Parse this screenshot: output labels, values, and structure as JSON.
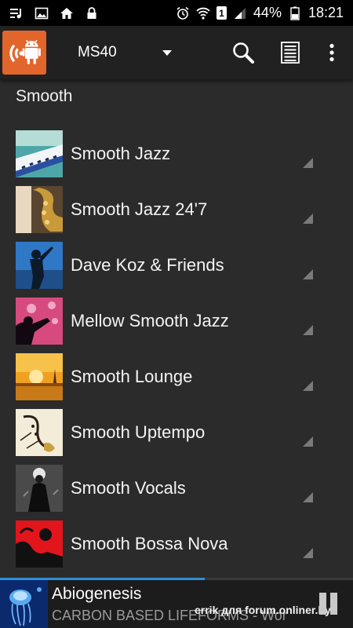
{
  "status_bar": {
    "battery": "44%",
    "time": "18:21",
    "sim_slot": "1",
    "icons_left": [
      "music-queue-icon",
      "image-icon",
      "home-icon",
      "lock-icon"
    ],
    "icons_right": [
      "alarm-icon",
      "wifi-icon",
      "sim-icon",
      "signal-icon",
      "battery-icon"
    ]
  },
  "app_bar": {
    "station": "MS40",
    "icons": [
      "app-logo",
      "search-icon",
      "playlist-icon",
      "more-vert-icon"
    ]
  },
  "section": {
    "title": "Smooth"
  },
  "channels": [
    {
      "label": "Smooth Jazz",
      "art": "keyboard-art"
    },
    {
      "label": "Smooth Jazz 24'7",
      "art": "saxophone-art"
    },
    {
      "label": "Dave Koz & Friends",
      "art": "sax-silhouette-art"
    },
    {
      "label": "Mellow Smooth Jazz",
      "art": "sax-player-pink-art"
    },
    {
      "label": "Smooth Lounge",
      "art": "sunset-art"
    },
    {
      "label": "Smooth Uptempo",
      "art": "sax-sketch-art"
    },
    {
      "label": "Smooth Vocals",
      "art": "singer-art"
    },
    {
      "label": "Smooth Bossa Nova",
      "art": "red-black-art"
    }
  ],
  "now_playing": {
    "title": "Abiogenesis",
    "subtitle": "CARBON BASED LIFEFORMS - World Of Sleepers",
    "watermark": "errik для forum.onliner.by",
    "progress": 0.58,
    "art": "jellyfish-art"
  },
  "colors": {
    "background": "#2b2b2b",
    "app_bar": "#212121",
    "logo": "#e2652c",
    "progress": "#2e8fd6"
  }
}
